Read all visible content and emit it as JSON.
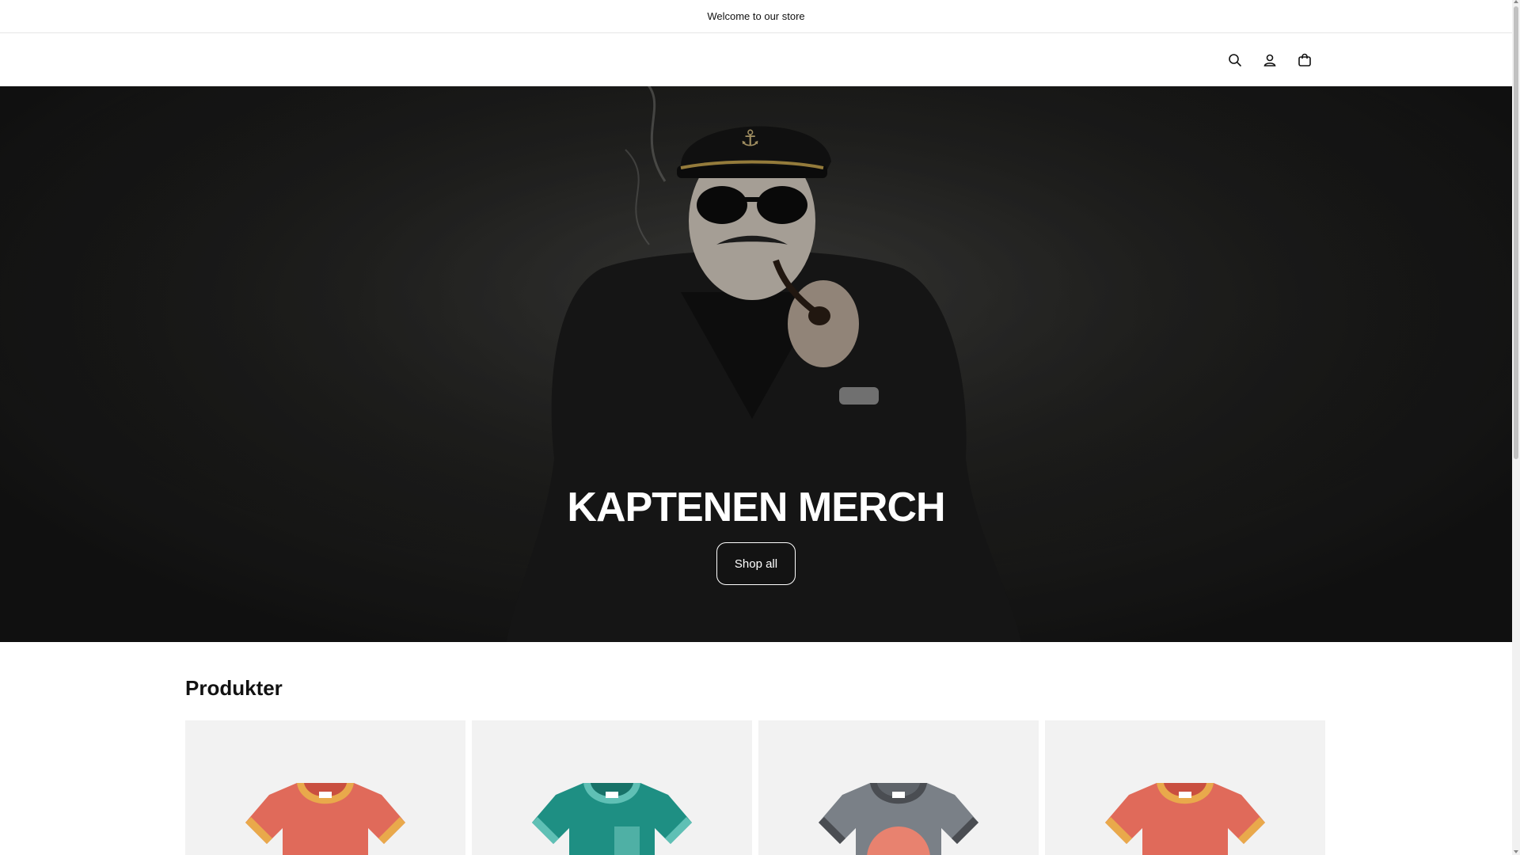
{
  "announcement": {
    "text": "Welcome to our store"
  },
  "header": {
    "icons": [
      "search-icon",
      "account-icon",
      "cart-icon"
    ]
  },
  "hero": {
    "title": "KAPTENEN MERCH",
    "button_label": "Shop all"
  },
  "products": {
    "title": "Produkter",
    "items": [
      {
        "icon": "tshirt-icon",
        "color": "#e06a5a",
        "trim": "#e9a94b"
      },
      {
        "icon": "tshirt-icon",
        "color": "#1e8f83",
        "trim": "#5fc0b5"
      },
      {
        "icon": "tshirt-icon",
        "color": "#7a8087",
        "trim": "#4a4d52"
      },
      {
        "icon": "tshirt-icon",
        "color": "#e06a5a",
        "trim": "#e9a94b"
      }
    ]
  }
}
